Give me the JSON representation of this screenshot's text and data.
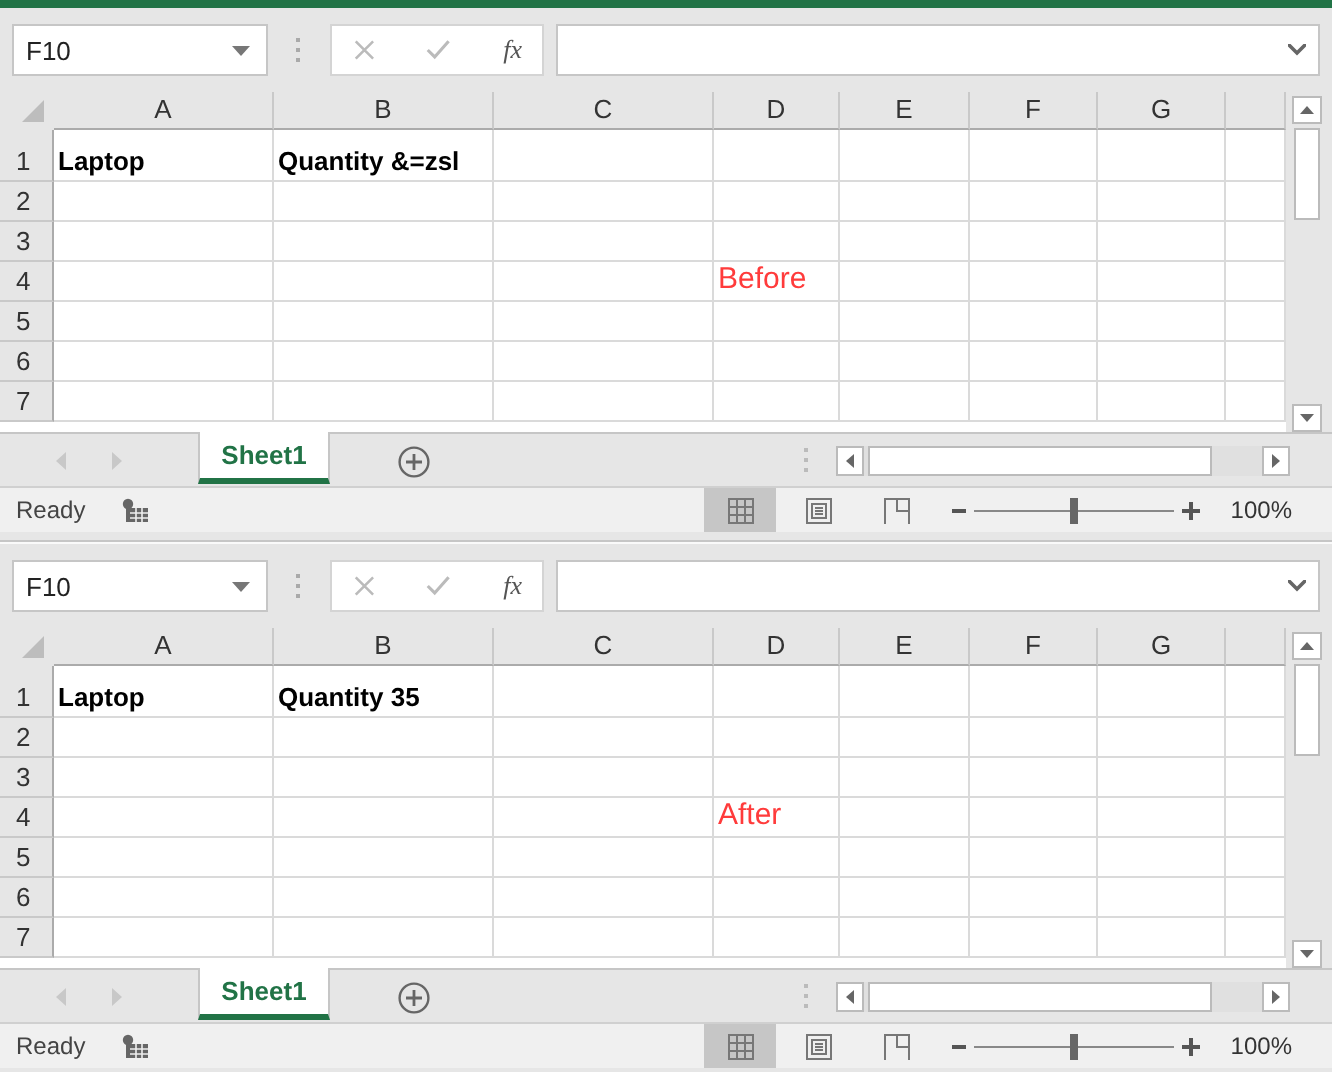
{
  "panes": [
    {
      "name_box": "F10",
      "function_symbol": "fx",
      "columns": [
        "A",
        "B",
        "C",
        "D",
        "E",
        "F",
        "G"
      ],
      "rows": [
        {
          "number": "1",
          "cells": [
            {
              "text": "Laptop",
              "bold": true
            },
            {
              "text": "Quantity &=zsl",
              "bold": true
            }
          ]
        },
        {
          "number": "2",
          "cells": []
        },
        {
          "number": "3",
          "cells": []
        },
        {
          "number": "4",
          "cells": [
            null,
            null,
            null,
            {
              "text": "Before",
              "bold": false,
              "color": "#ff3b3b"
            }
          ]
        },
        {
          "number": "5",
          "cells": []
        },
        {
          "number": "6",
          "cells": []
        },
        {
          "number": "7",
          "cells": []
        }
      ],
      "sheet_tabs": [
        {
          "label": "Sheet1",
          "selected": true
        }
      ],
      "status": "Ready",
      "views": [
        {
          "kind": "normal",
          "selected": true
        },
        {
          "kind": "page_layout",
          "selected": false
        },
        {
          "kind": "page_break",
          "selected": false
        }
      ],
      "zoom_slider": {
        "level": 0.5
      },
      "zoom": "100%"
    },
    {
      "name_box": "F10",
      "function_symbol": "fx",
      "columns": [
        "A",
        "B",
        "C",
        "D",
        "E",
        "F",
        "G"
      ],
      "rows": [
        {
          "number": "1",
          "cells": [
            {
              "text": "Laptop",
              "bold": true
            },
            {
              "text": "Quantity 35",
              "bold": true
            }
          ]
        },
        {
          "number": "2",
          "cells": []
        },
        {
          "number": "3",
          "cells": []
        },
        {
          "number": "4",
          "cells": [
            null,
            null,
            null,
            {
              "text": "After",
              "bold": false,
              "color": "#ff3b3b"
            }
          ]
        },
        {
          "number": "5",
          "cells": []
        },
        {
          "number": "6",
          "cells": []
        },
        {
          "number": "7",
          "cells": []
        }
      ],
      "sheet_tabs": [
        {
          "label": "Sheet1",
          "selected": true
        }
      ],
      "status": "Ready",
      "views": [
        {
          "kind": "normal",
          "selected": true
        },
        {
          "kind": "page_layout",
          "selected": false
        },
        {
          "kind": "page_break",
          "selected": false
        }
      ],
      "zoom_slider": {
        "level": 0.5
      },
      "zoom": "100%"
    }
  ]
}
